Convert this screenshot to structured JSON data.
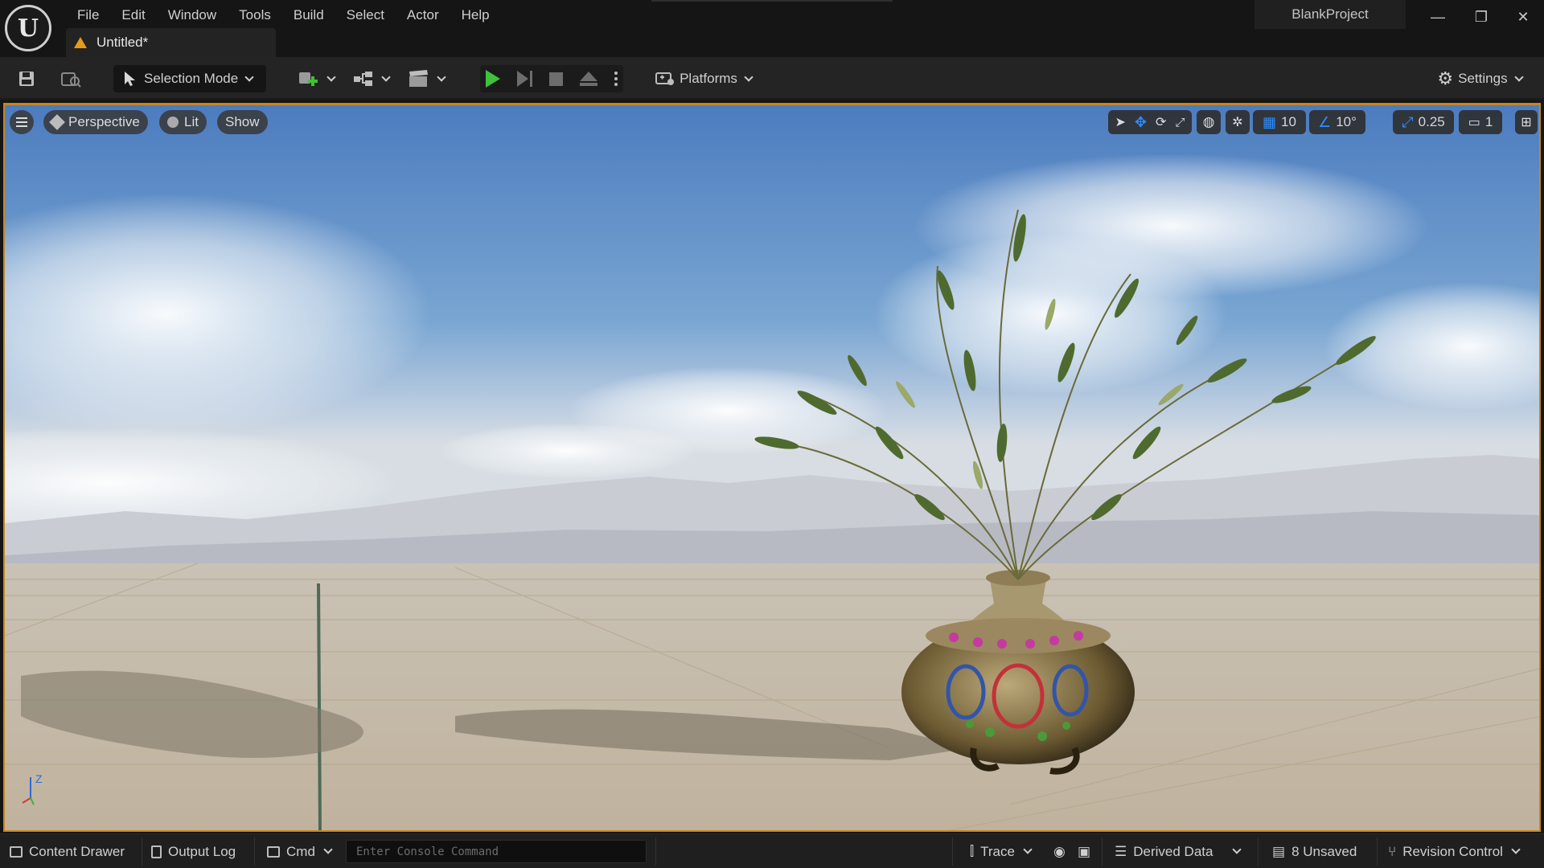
{
  "app": {
    "logo_letter": "U",
    "project_name": "BlankProject",
    "document_tab": "Untitled*"
  },
  "menu": [
    "File",
    "Edit",
    "Window",
    "Tools",
    "Build",
    "Select",
    "Actor",
    "Help"
  ],
  "window_controls": {
    "minimize": "—",
    "restore": "❐",
    "close": "✕"
  },
  "toolbar": {
    "selection_mode": "Selection Mode",
    "platforms": "Platforms",
    "settings": "Settings"
  },
  "viewport": {
    "view_mode": "Perspective",
    "lighting": "Lit",
    "show": "Show",
    "grid_snap": "10",
    "rotation_snap": "10°",
    "scale_snap": "0.25",
    "camera_speed": "1",
    "gizmo_z": "Z"
  },
  "statusbar": {
    "content_drawer": "Content Drawer",
    "output_log": "Output Log",
    "cmd": "Cmd",
    "console_placeholder": "Enter Console Command",
    "trace": "Trace",
    "derived_data": "Derived Data",
    "unsaved": "8 Unsaved",
    "revision_control": "Revision Control"
  },
  "colors": {
    "accent_orange": "#c7861f",
    "play_green": "#3fc13a",
    "active_blue": "#2f8cff",
    "warning_yellow": "#e59a1c"
  }
}
